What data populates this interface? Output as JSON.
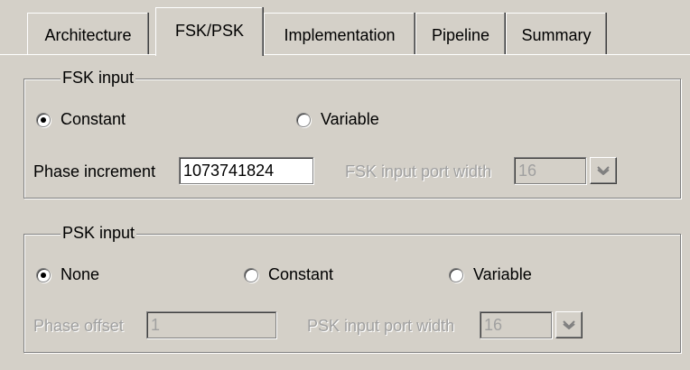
{
  "tabs": [
    {
      "label": "Architecture",
      "active": false
    },
    {
      "label": "FSK/PSK",
      "active": true
    },
    {
      "label": "Implementation",
      "active": false
    },
    {
      "label": "Pipeline",
      "active": false
    },
    {
      "label": "Summary",
      "active": false
    }
  ],
  "fsk": {
    "legend": "FSK input",
    "radio_constant": "Constant",
    "radio_variable": "Variable",
    "selected": "Constant",
    "phase_increment_label": "Phase increment",
    "phase_increment_value": "1073741824",
    "port_width_label": "FSK input port width",
    "port_width_value": "16"
  },
  "psk": {
    "legend": "PSK input",
    "radio_none": "None",
    "radio_constant": "Constant",
    "radio_variable": "Variable",
    "selected": "None",
    "phase_offset_label": "Phase offset",
    "phase_offset_value": "1",
    "port_width_label": "PSK input port width",
    "port_width_value": "16"
  },
  "colors": {
    "face": "#d4d0c8",
    "shadow": "#808080",
    "disabled_text": "#a0a0a0"
  },
  "icons": {
    "dropdown": "chevron-down-icon"
  }
}
